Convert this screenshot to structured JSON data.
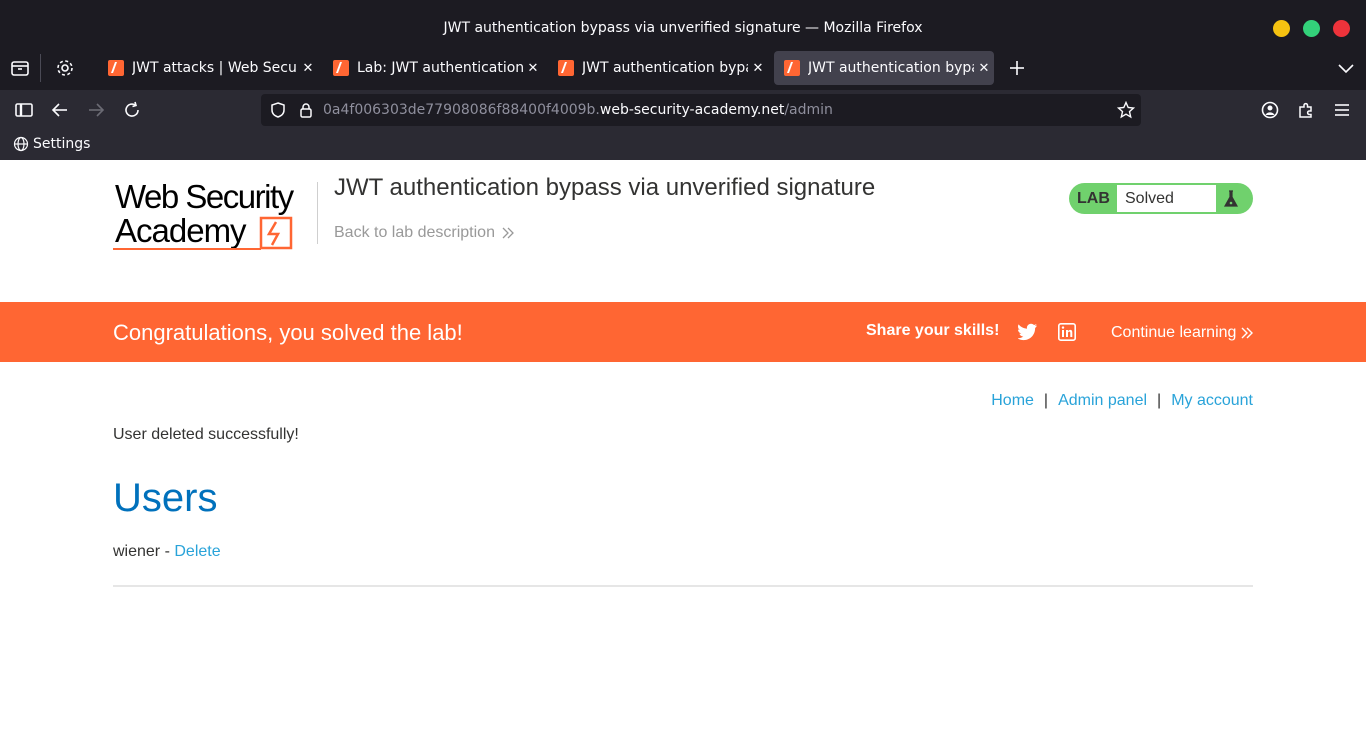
{
  "window": {
    "title": "JWT authentication bypass via unverified signature — Mozilla Firefox"
  },
  "tabs": [
    {
      "label": "JWT attacks | Web Security Academy",
      "active": false
    },
    {
      "label": "Lab: JWT authentication bypass via unverified signature",
      "active": false
    },
    {
      "label": "JWT authentication bypass via unverified signature",
      "active": false
    },
    {
      "label": "JWT authentication bypass via unverified signature",
      "active": true
    }
  ],
  "urlbar": {
    "subdomain": "0a4f006303de77908086f88400f4009b.",
    "domain": "web-security-academy.net",
    "path": "/admin"
  },
  "bookmarks": {
    "settings_label": "Settings"
  },
  "header": {
    "logo_line1": "Web Security",
    "logo_line2": "Academy",
    "lab_title": "JWT authentication bypass via unverified signature",
    "back_link": "Back to lab description",
    "status_tag": "LAB",
    "status_text": "Solved"
  },
  "banner": {
    "congrats": "Congratulations, you solved the lab!",
    "share": "Share your skills!",
    "continue": "Continue learning"
  },
  "nav": {
    "home": "Home",
    "sep1": "|",
    "admin_panel": "Admin panel",
    "sep2": "|",
    "my_account": "My account"
  },
  "main": {
    "message": "User deleted successfully!",
    "heading": "Users",
    "user_name": "wiener",
    "separator": " - ",
    "delete_label": "Delete"
  },
  "colors": {
    "accent_orange": "#ff6633",
    "link_blue": "#29a3d9",
    "heading_blue": "#0071bc",
    "solved_green": "#70d16d"
  }
}
